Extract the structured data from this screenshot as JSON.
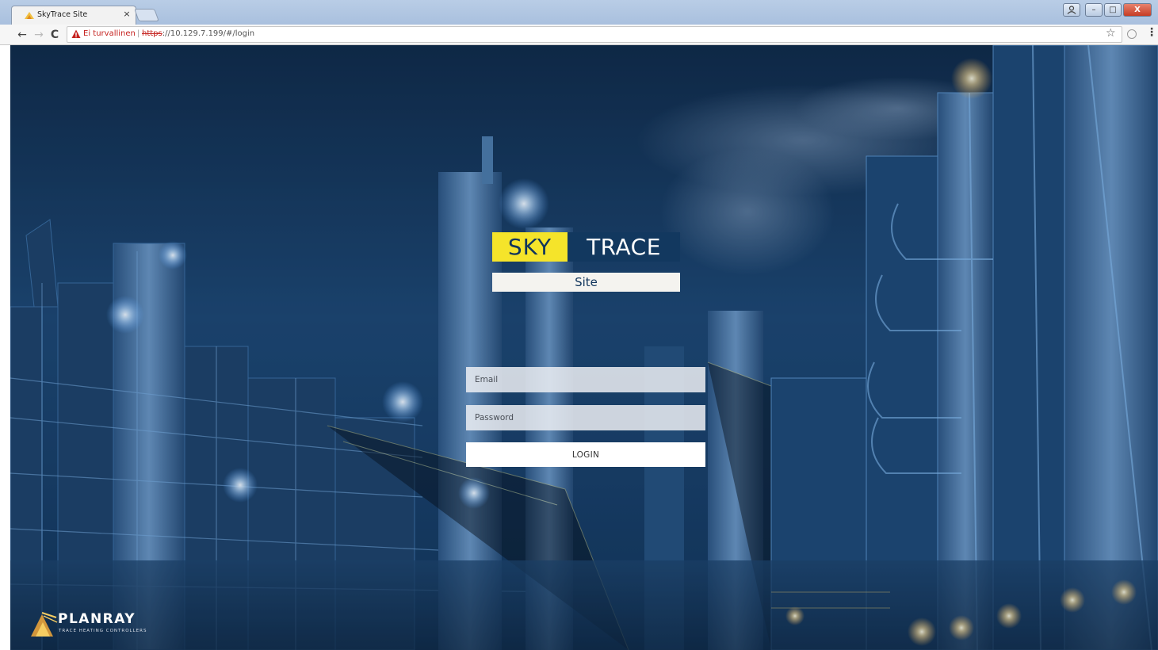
{
  "browser": {
    "tab": {
      "title": "SkyTrace Site",
      "close_glyph": "×",
      "favicon": "planray-flame-icon"
    },
    "nav": {
      "back": "←",
      "forward": "→",
      "reload": "C"
    },
    "address": {
      "security_label": "Ei turvallinen",
      "separator": "|",
      "scheme": "https",
      "rest": "://10.129.7.199/#/login"
    },
    "window_controls": {
      "minimize": "–",
      "maximize": "□",
      "close": "X"
    },
    "bookmark_glyph": "☆",
    "menu_glyph": "⋮"
  },
  "page": {
    "logo": {
      "left": "SKY",
      "right": "TRACE",
      "subtitle": "Site"
    },
    "form": {
      "email_placeholder": "Email",
      "password_placeholder": "Password",
      "login_label": "LOGIN"
    },
    "brand": {
      "name": "PLANRAY",
      "tagline": "TRACE HEATING CONTROLLERS"
    }
  },
  "colors": {
    "logo_yellow": "#f5e42a",
    "logo_navy": "#12385f",
    "background_night": "#0f2a47",
    "not_secure_red": "#c5221f"
  }
}
